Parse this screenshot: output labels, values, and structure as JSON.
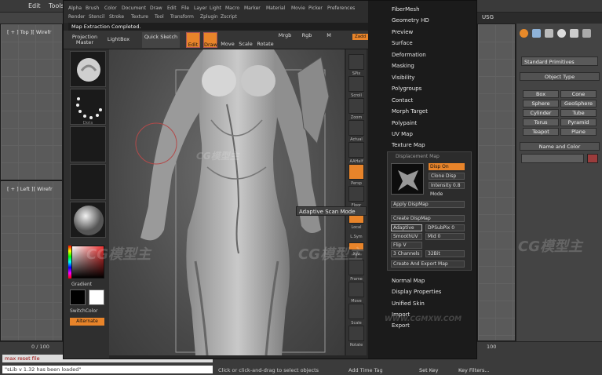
{
  "max": {
    "menu": [
      "Edit",
      "Tools"
    ],
    "usg": "USG",
    "viewports": {
      "top": "[ + ] Top ][ Wirefr",
      "left": "[ + ] Left ][ Wirefr"
    },
    "command_panel": {
      "dropdown": "Standard Primitives",
      "object_type_title": "Object Type",
      "object_buttons": [
        "Box",
        "Cone",
        "Sphere",
        "GeoSphere",
        "Cylinder",
        "Tube",
        "Torus",
        "Pyramid",
        "Teapot",
        "Plane"
      ],
      "name_color_title": "Name and Color"
    },
    "bottom": {
      "timeline": "0 / 100",
      "frame_end": "100",
      "listener_1": "max reset file",
      "listener_2": "\"sLib v 1.32 has been loaded\"",
      "status": "Click or click-and-drag to select objects",
      "add_time_tag": "Add Time Tag",
      "set_key": "Set Key",
      "key_filters": "Key Filters..."
    }
  },
  "zbrush": {
    "menu_row1": [
      "Alpha",
      "Brush",
      "Color",
      "Document",
      "Draw",
      "Edit",
      "File",
      "Layer",
      "Light",
      "Macro",
      "Marker",
      "Material",
      "Movie",
      "Picker",
      "Preferences"
    ],
    "menu_row2": [
      "Render",
      "Stencil",
      "Stroke",
      "Texture",
      "Tool",
      "Transform",
      "Zplugin",
      "Zscript"
    ],
    "notice": "Map Extraction Completed.",
    "shelf": {
      "projection_master": "Projection Master",
      "lightbox": "LightBox",
      "quick_sketch": "Quick Sketch",
      "edit": "Edit",
      "draw": "Draw",
      "move": "Move",
      "scale": "Scale",
      "rotate": "Rotate",
      "mrgb": "Mrgb",
      "rgb": "Rgb",
      "m": "M",
      "zadd": "Zadd"
    },
    "left_tray": {
      "dots_label": "Dots",
      "gradient": "Gradient",
      "switch_color": "SwitchColor",
      "alternate": "Alternate"
    },
    "right_shelf": [
      "SPix",
      "Scroll",
      "Zoom",
      "Actual",
      "AAHalf",
      "Persp",
      "Floor",
      "Local",
      "L.Sym",
      "Xyz",
      "Frame",
      "Move",
      "Scale",
      "Rotate"
    ],
    "palette": {
      "items": [
        "FiberMesh",
        "Geometry HD",
        "Preview",
        "Surface",
        "Deformation",
        "Masking",
        "Visibility",
        "Polygroups",
        "Contact",
        "Morph Target",
        "Polypaint",
        "UV Map",
        "Texture Map"
      ],
      "displacement": {
        "title": "Displacement Map",
        "disp_on": "Disp On",
        "clone_disp": "Clone Disp",
        "intensity": "Intensity 0.8",
        "mode": "Mode",
        "apply": "Apply DispMap",
        "create": "Create DispMap",
        "adaptive": "Adaptive",
        "dpsubpix": "DPSubPix 0",
        "smooth_uv": "SmoothUV",
        "mid": "Mid 0",
        "flip_v": "Flip V",
        "channels": "3 Channels",
        "bits": "32Bit",
        "create_export": "Create And Export Map"
      },
      "items_after": [
        "Normal Map",
        "Display Properties",
        "Unified Skin",
        "Import",
        "Export"
      ]
    },
    "tooltip": "Adaptive Scan Mode"
  },
  "watermark": "CG模型主",
  "watermark_url": "WWW.CGMXW.COM",
  "colors": {
    "accent": "#e8842a",
    "panel": "#1b1b1b"
  }
}
